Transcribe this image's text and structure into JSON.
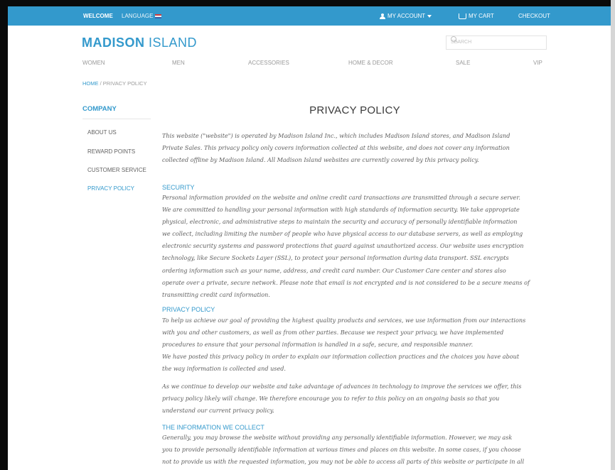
{
  "topbar": {
    "welcome": "WELCOME",
    "language": "LANGUAGE",
    "my_account": "MY ACCOUNT",
    "my_cart": "MY CART",
    "checkout": "CHECKOUT"
  },
  "header": {
    "logo_bold": "MADISON",
    "logo_light": " ISLAND",
    "search_placeholder": "SEARCH"
  },
  "nav": [
    "WOMEN",
    "MEN",
    "ACCESSORIES",
    "HOME & DECOR",
    "SALE",
    "VIP"
  ],
  "breadcrumb": {
    "home": "HOME",
    "separator": " / ",
    "current": "PRIVACY POLICY"
  },
  "sidebar": {
    "title": "COMPANY",
    "items": [
      "ABOUT US",
      "REWARD POINTS",
      "CUSTOMER SERVICE",
      "PRIVACY POLICY"
    ],
    "active_index": 3
  },
  "content": {
    "title": "PRIVACY POLICY",
    "intro": [
      "This website (\"website\") is operated by Madison Island Inc., which includes Madison Island stores, and Madison Island",
      "Private Sales. This privacy policy only covers information collected at this website, and does not cover any information",
      "collected offline by Madison Island. All Madison Island websites are currently covered by this privacy policy."
    ],
    "security_heading": "SECURITY",
    "security": [
      "Personal information provided on the website and online credit card transactions are transmitted through a secure server.",
      "We are committed to handling your personal information with high standards of information security. We take appropriate",
      "physical, electronic, and administrative steps to maintain the security and accuracy of personally identifiable information",
      "we collect, including limiting the number of people who have physical access to our database servers, as well as employing",
      "electronic security systems and password protections that guard against unauthorized access. Our website uses encryption",
      "technology, like Secure Sockets Layer (SSL), to protect your personal information during data transport. SSL encrypts",
      "ordering information such as your name, address, and credit card number. Our Customer Care center and stores also",
      "operate over a private, secure network. Please note that email is not encrypted and is not considered to be a secure means of",
      "transmitting credit card information."
    ],
    "privacy_heading": "PRIVACY POLICY",
    "privacy": [
      "To help us achieve our goal of providing the highest quality products and services, we use information from our interactions",
      "with you and other customers, as well as from other parties. Because we respect your privacy, we have implemented",
      "procedures to ensure that your personal information is handled in a safe, secure, and responsible manner.",
      "We have posted this privacy policy in order to explain our information collection practices and the choices you have about",
      "the way information is collected and used."
    ],
    "changes": [
      "As we continue to develop our website and take advantage of advances in technology to improve the services we offer, this",
      "privacy policy likely will change. We therefore encourage you to refer to this policy on an ongoing basis so that you",
      "understand our current privacy policy."
    ],
    "collect_heading": "THE INFORMATION WE COLLECT",
    "collect": [
      "Generally, you may browse the website without providing any personally identifiable information. However, we may ask",
      "you to provide personally identifiable information at various times and places on this website. In some cases, if you choose",
      "not to provide us with the requested information, you may not be able to access all parts of this website or participate in all"
    ]
  },
  "colors": {
    "accent": "#3399cc",
    "text": "#636363",
    "muted": "#9a9a9a"
  }
}
